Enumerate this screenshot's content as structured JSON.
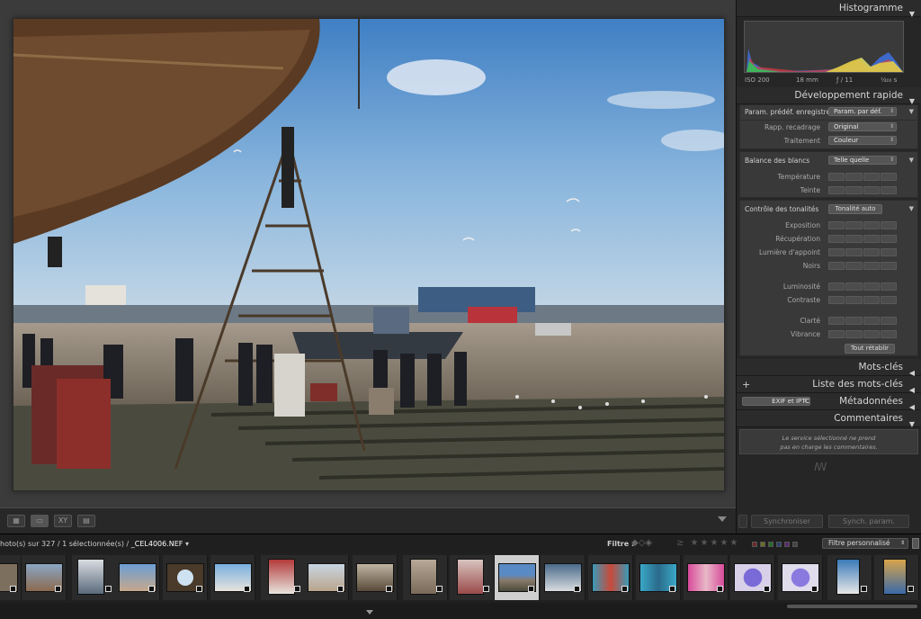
{
  "right_panel": {
    "histogram": {
      "title": "Histogramme",
      "iso": "ISO 200",
      "focal": "18 mm",
      "aperture": "ƒ / 11",
      "shutter": "¹⁄₄₀₀ s"
    },
    "quick_develop": {
      "title": "Développement rapide",
      "preset_label": "Param. prédéf. enregistré",
      "preset_value": "Param. par déf.",
      "crop_label": "Rapp. recadrage",
      "crop_value": "Original",
      "treatment_label": "Traitement",
      "treatment_value": "Couleur",
      "wb_label": "Balance des blancs",
      "wb_value": "Telle quelle",
      "temperature_label": "Température",
      "tint_label": "Teinte",
      "tone_label": "Contrôle des tonalités",
      "auto_tone": "Tonalité auto",
      "exposure_label": "Exposition",
      "recovery_label": "Récupération",
      "fill_label": "Lumière d'appoint",
      "blacks_label": "Noirs",
      "brightness_label": "Luminosité",
      "contrast_label": "Contraste",
      "clarity_label": "Clarté",
      "vibrance_label": "Vibrance",
      "reset": "Tout rétablir"
    },
    "keywords": "Mots-clés",
    "keyword_list": "Liste des mots-clés",
    "metadata": {
      "title": "Métadonnées",
      "preset": "EXIF et IPTC"
    },
    "comments": {
      "title": "Commentaires",
      "message_line1": "Le service sélectionné ne prend",
      "message_line2": "pas en charge les commentaires."
    },
    "sync_button": "Synchroniser",
    "sync_settings_button": "Synch. param."
  },
  "filmstrip_bar": {
    "info": "hoto(s) sur 327 / 1 sélectionnée(s) / ",
    "filename": "_CEL4006.NEF",
    "filter_label": "Filtre :",
    "stars": "≥ ★★★★★",
    "filter_preset": "Filtre personnalisé"
  },
  "colors": {
    "panel_bg": "#262626",
    "center_bg": "#3b3b3b",
    "selected_thumb": "#cfcfcf"
  }
}
